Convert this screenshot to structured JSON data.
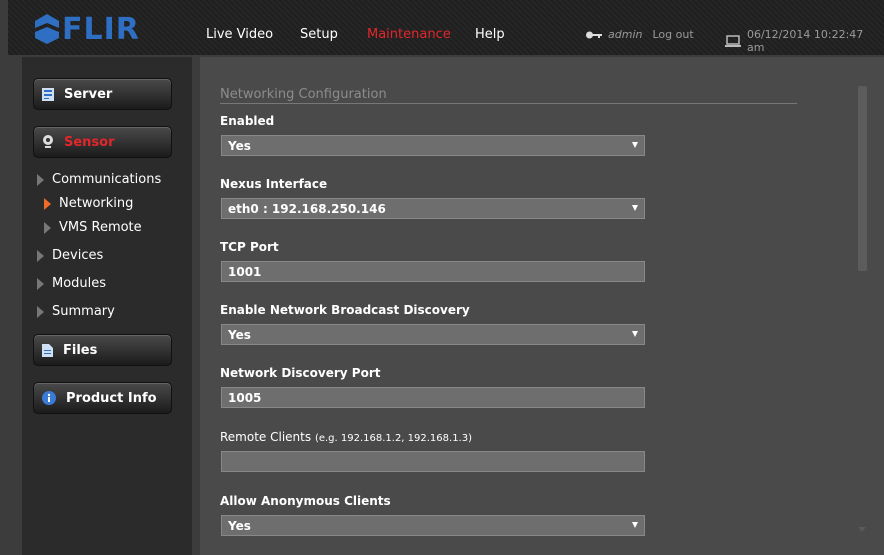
{
  "app": {
    "logo_text": "FLIR"
  },
  "nav": {
    "live_video": "Live Video",
    "setup": "Setup",
    "maintenance": "Maintenance",
    "help": "Help"
  },
  "user": {
    "name": "admin",
    "logout": "Log out"
  },
  "datetime": "06/12/2014 10:22:47 am",
  "sidebar": {
    "server": "Server",
    "sensor": "Sensor",
    "items": [
      {
        "label": "Communications"
      },
      {
        "label": "Networking"
      },
      {
        "label": "VMS Remote"
      },
      {
        "label": "Devices"
      },
      {
        "label": "Modules"
      },
      {
        "label": "Summary"
      }
    ],
    "files": "Files",
    "product_info": "Product Info"
  },
  "form": {
    "section_title": "Networking Configuration",
    "enabled": {
      "label": "Enabled",
      "value": "Yes"
    },
    "nexus_interface": {
      "label": "Nexus Interface",
      "value": "eth0 : 192.168.250.146"
    },
    "tcp_port": {
      "label": "TCP Port",
      "value": "1001"
    },
    "broadcast_discovery": {
      "label": "Enable Network Broadcast Discovery",
      "value": "Yes"
    },
    "discovery_port": {
      "label": "Network Discovery Port",
      "value": "1005"
    },
    "remote_clients": {
      "label": "Remote Clients",
      "hint": "(e.g. 192.168.1.2, 192.168.1.3)",
      "value": ""
    },
    "anonymous_clients": {
      "label": "Allow Anonymous Clients",
      "value": "Yes"
    }
  },
  "colors": {
    "accent_red": "#e3262b",
    "logo_blue": "#2e6fc3",
    "active_arrow": "#f06a28"
  }
}
